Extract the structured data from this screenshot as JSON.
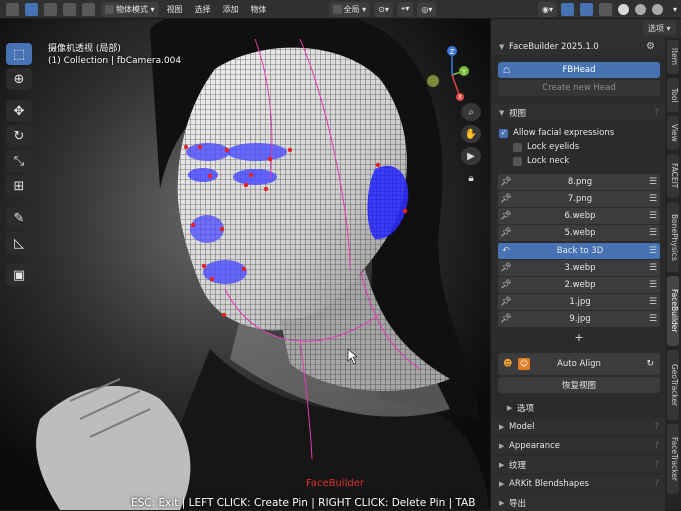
{
  "topbar": {
    "mode": "物体模式",
    "menus": [
      "视图",
      "选择",
      "添加",
      "物体"
    ],
    "transform_orientation": "全局"
  },
  "viewport": {
    "title_line1": "摄像机透视 (局部)",
    "title_line2": "(1) Collection | fbCamera.004",
    "gizmo": {
      "x": "X",
      "y": "Y",
      "z": "Z"
    },
    "facebuilder_label": "FaceBuilder",
    "status_text": "ESC: Exit | LEFT CLICK: Create Pin | RIGHT CLICK: Delete Pin | TAB"
  },
  "panel": {
    "options_label": "选项",
    "title": "FaceBuilder 2025.1.0",
    "head_button": "FBHead",
    "create_new_head": "Create new Head",
    "view_section": "视图",
    "allow_facial_expressions": "Allow facial expressions",
    "lock_eyelids": "Lock eyelids",
    "lock_neck": "Lock neck",
    "cameras": [
      {
        "name": "8.png"
      },
      {
        "name": "7.png"
      },
      {
        "name": "6.webp"
      },
      {
        "name": "5.webp"
      },
      {
        "name": "Back to 3D",
        "active": true
      },
      {
        "name": "3.webp"
      },
      {
        "name": "2.webp"
      },
      {
        "name": "1.jpg"
      },
      {
        "name": "9.jpg"
      }
    ],
    "add_symbol": "+",
    "auto_align": "Auto Align",
    "restore_view": "恢复视图",
    "options_sub": "选项",
    "sections": [
      "Model",
      "Appearance",
      "纹理",
      "ARKit Blendshapes",
      "导出"
    ]
  },
  "side_tabs": [
    "Item",
    "Tool",
    "View",
    "FACEIT",
    "BonePhysics",
    "FaceBuilder",
    "GeoTracker",
    "FaceTracker"
  ],
  "colors": {
    "accent": "#4772b3",
    "panel_bg": "#2b2b2b",
    "mesh_wire": "#1a1a1a",
    "pin": "#e52222",
    "highlight_region": "#3a3aff",
    "facebuilder_label": "#e0322c"
  }
}
